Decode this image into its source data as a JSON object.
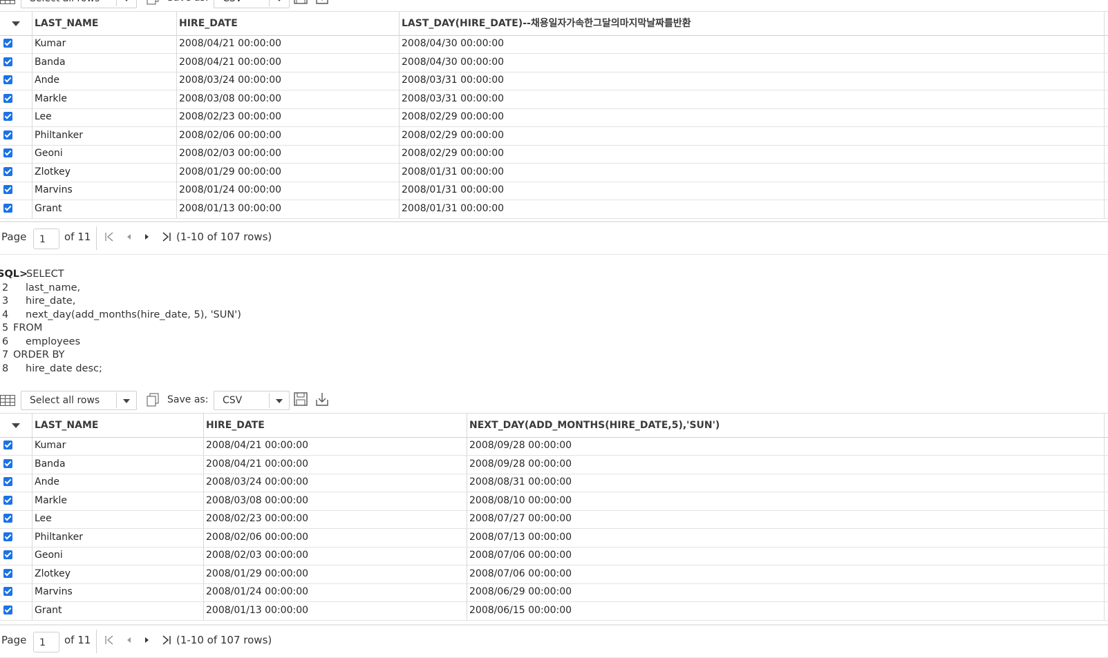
{
  "toolbar": {
    "select_label": "Select all rows",
    "save_as_label": "Save as:",
    "format_value": "CSV"
  },
  "table1": {
    "columns": [
      "LAST_NAME",
      "HIRE_DATE",
      "LAST_DAY(HIRE_DATE)--채용일자가속한그달의마지막날짜를반환"
    ],
    "rows": [
      [
        "Kumar",
        "2008/04/21 00:00:00",
        "2008/04/30 00:00:00"
      ],
      [
        "Banda",
        "2008/04/21 00:00:00",
        "2008/04/30 00:00:00"
      ],
      [
        "Ande",
        "2008/03/24 00:00:00",
        "2008/03/31 00:00:00"
      ],
      [
        "Markle",
        "2008/03/08 00:00:00",
        "2008/03/31 00:00:00"
      ],
      [
        "Lee",
        "2008/02/23 00:00:00",
        "2008/02/29 00:00:00"
      ],
      [
        "Philtanker",
        "2008/02/06 00:00:00",
        "2008/02/29 00:00:00"
      ],
      [
        "Geoni",
        "2008/02/03 00:00:00",
        "2008/02/29 00:00:00"
      ],
      [
        "Zlotkey",
        "2008/01/29 00:00:00",
        "2008/01/31 00:00:00"
      ],
      [
        "Marvins",
        "2008/01/24 00:00:00",
        "2008/01/31 00:00:00"
      ],
      [
        "Grant",
        "2008/01/13 00:00:00",
        "2008/01/31 00:00:00"
      ]
    ]
  },
  "table2": {
    "columns": [
      "LAST_NAME",
      "HIRE_DATE",
      "NEXT_DAY(ADD_MONTHS(HIRE_DATE,5),'SUN')"
    ],
    "rows": [
      [
        "Kumar",
        "2008/04/21 00:00:00",
        "2008/09/28 00:00:00"
      ],
      [
        "Banda",
        "2008/04/21 00:00:00",
        "2008/09/28 00:00:00"
      ],
      [
        "Ande",
        "2008/03/24 00:00:00",
        "2008/08/31 00:00:00"
      ],
      [
        "Markle",
        "2008/03/08 00:00:00",
        "2008/08/10 00:00:00"
      ],
      [
        "Lee",
        "2008/02/23 00:00:00",
        "2008/07/27 00:00:00"
      ],
      [
        "Philtanker",
        "2008/02/06 00:00:00",
        "2008/07/13 00:00:00"
      ],
      [
        "Geoni",
        "2008/02/03 00:00:00",
        "2008/07/06 00:00:00"
      ],
      [
        "Zlotkey",
        "2008/01/29 00:00:00",
        "2008/07/06 00:00:00"
      ],
      [
        "Marvins",
        "2008/01/24 00:00:00",
        "2008/06/29 00:00:00"
      ],
      [
        "Grant",
        "2008/01/13 00:00:00",
        "2008/06/15 00:00:00"
      ]
    ]
  },
  "pager": {
    "page_label": "Page",
    "page_value": "1",
    "of_label": "of 11",
    "rows_info": "(1-10 of 107 rows)"
  },
  "sql": {
    "prompt": "SQL>",
    "lines": [
      {
        "num": "",
        "text": "SELECT"
      },
      {
        "num": "2",
        "text": "last_name,"
      },
      {
        "num": "3",
        "text": "hire_date,"
      },
      {
        "num": "4",
        "text": "next_day(add_months(hire_date, 5), 'SUN')"
      },
      {
        "num": "5",
        "text": "FROM"
      },
      {
        "num": "6",
        "text": "employees"
      },
      {
        "num": "7",
        "text": "ORDER BY"
      },
      {
        "num": "8",
        "text": "hire_date desc;"
      }
    ]
  },
  "colors": {
    "checkbox": "#1a73e8",
    "border": "#d8d8d8"
  }
}
